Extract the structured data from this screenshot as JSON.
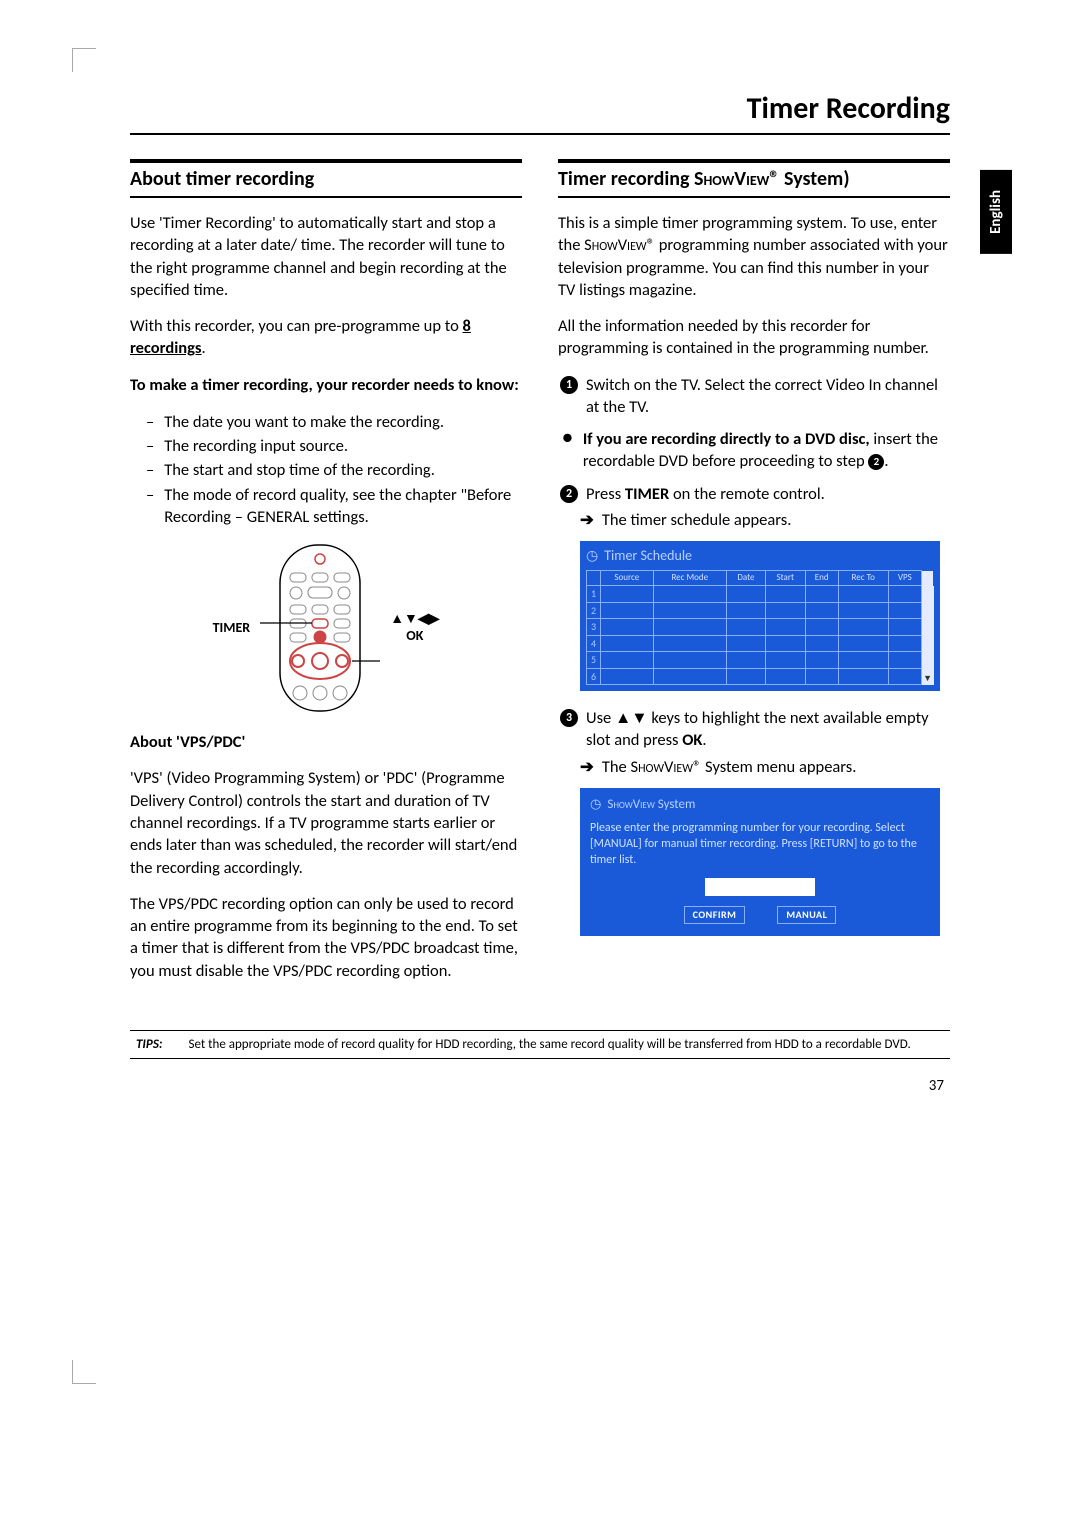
{
  "page": {
    "main_title": "Timer Recording",
    "language_tab": "English",
    "page_number": "37"
  },
  "left": {
    "heading": "About timer recording",
    "p1_a": "Use 'Timer Recording' to automatically start and stop a recording at a later date/ time. The recorder will tune to the right programme channel and begin recording at the specified time.",
    "p2_a": "With this recorder, you can pre-programme up to ",
    "p2_b": "8 recordings",
    "p2_c": ".",
    "needs_head": "To make a timer recording, your recorder needs to know:",
    "needs": [
      "The date you want to make the recording.",
      "The recording input source.",
      "The start and stop time of the recording.",
      "The mode of record quality, see the chapter \"Before Recording – GENERAL settings."
    ],
    "remote_left": "TIMER",
    "remote_right_arrows": "▲▼◀▶",
    "remote_right_ok": "OK",
    "vps_head": "About 'VPS/PDC'",
    "vps_p1": "'VPS' (Video Programming System) or 'PDC' (Programme Delivery Control) controls the start and duration of TV channel recordings. If a TV programme starts earlier or ends later than was scheduled, the recorder will start/end the recording accordingly.",
    "vps_p2": "The VPS/PDC recording option can only be used to record an entire programme from its beginning to the end. To set a timer that is different from the VPS/PDC broadcast time, you must disable the VPS/PDC recording option."
  },
  "right": {
    "heading_a": "Timer recording ",
    "heading_b": "ShowView",
    "heading_c": "® System)",
    "p1_a": "This is a simple timer programming system. To use, enter the ",
    "p1_b": "ShowView",
    "p1_c": "® programming number associated with your television programme. You can find this number in your TV listings magazine.",
    "p2": "All the information needed by this recorder for programming is contained in the programming number.",
    "step1": "Switch on the TV. Select the correct Video In channel at the TV.",
    "bullet_a": "If you are recording directly to a DVD disc,",
    "bullet_b": " insert the recordable DVD before proceeding to step ",
    "step2_a": "Press ",
    "step2_b": "TIMER",
    "step2_c": " on the remote control.",
    "step2_arrow": "The timer schedule appears.",
    "osd1": {
      "title": "Timer Schedule",
      "cols": [
        "Source",
        "Rec Mode",
        "Date",
        "Start",
        "End",
        "Rec To",
        "VPS"
      ],
      "rows": [
        "1",
        "2",
        "3",
        "4",
        "5",
        "6"
      ]
    },
    "step3_a": "Use ▲▼ keys to highlight the next available empty slot and press ",
    "step3_b": "OK",
    "step3_c": ".",
    "step3_arrow_a": "The ",
    "step3_arrow_b": "ShowView",
    "step3_arrow_c": "® System menu appears.",
    "osd2": {
      "title_a": "ShowView",
      "title_b": " System",
      "body": "Please enter the programming number for your recording. Select [MANUAL] for manual timer recording. Press [RETURN] to go to the timer list.",
      "btn_confirm": "CONFIRM",
      "btn_manual": "MANUAL"
    }
  },
  "tips": {
    "label": "TIPS:",
    "text": "Set the appropriate mode of record quality for HDD recording, the same record quality will be transferred from HDD to a recordable DVD."
  }
}
